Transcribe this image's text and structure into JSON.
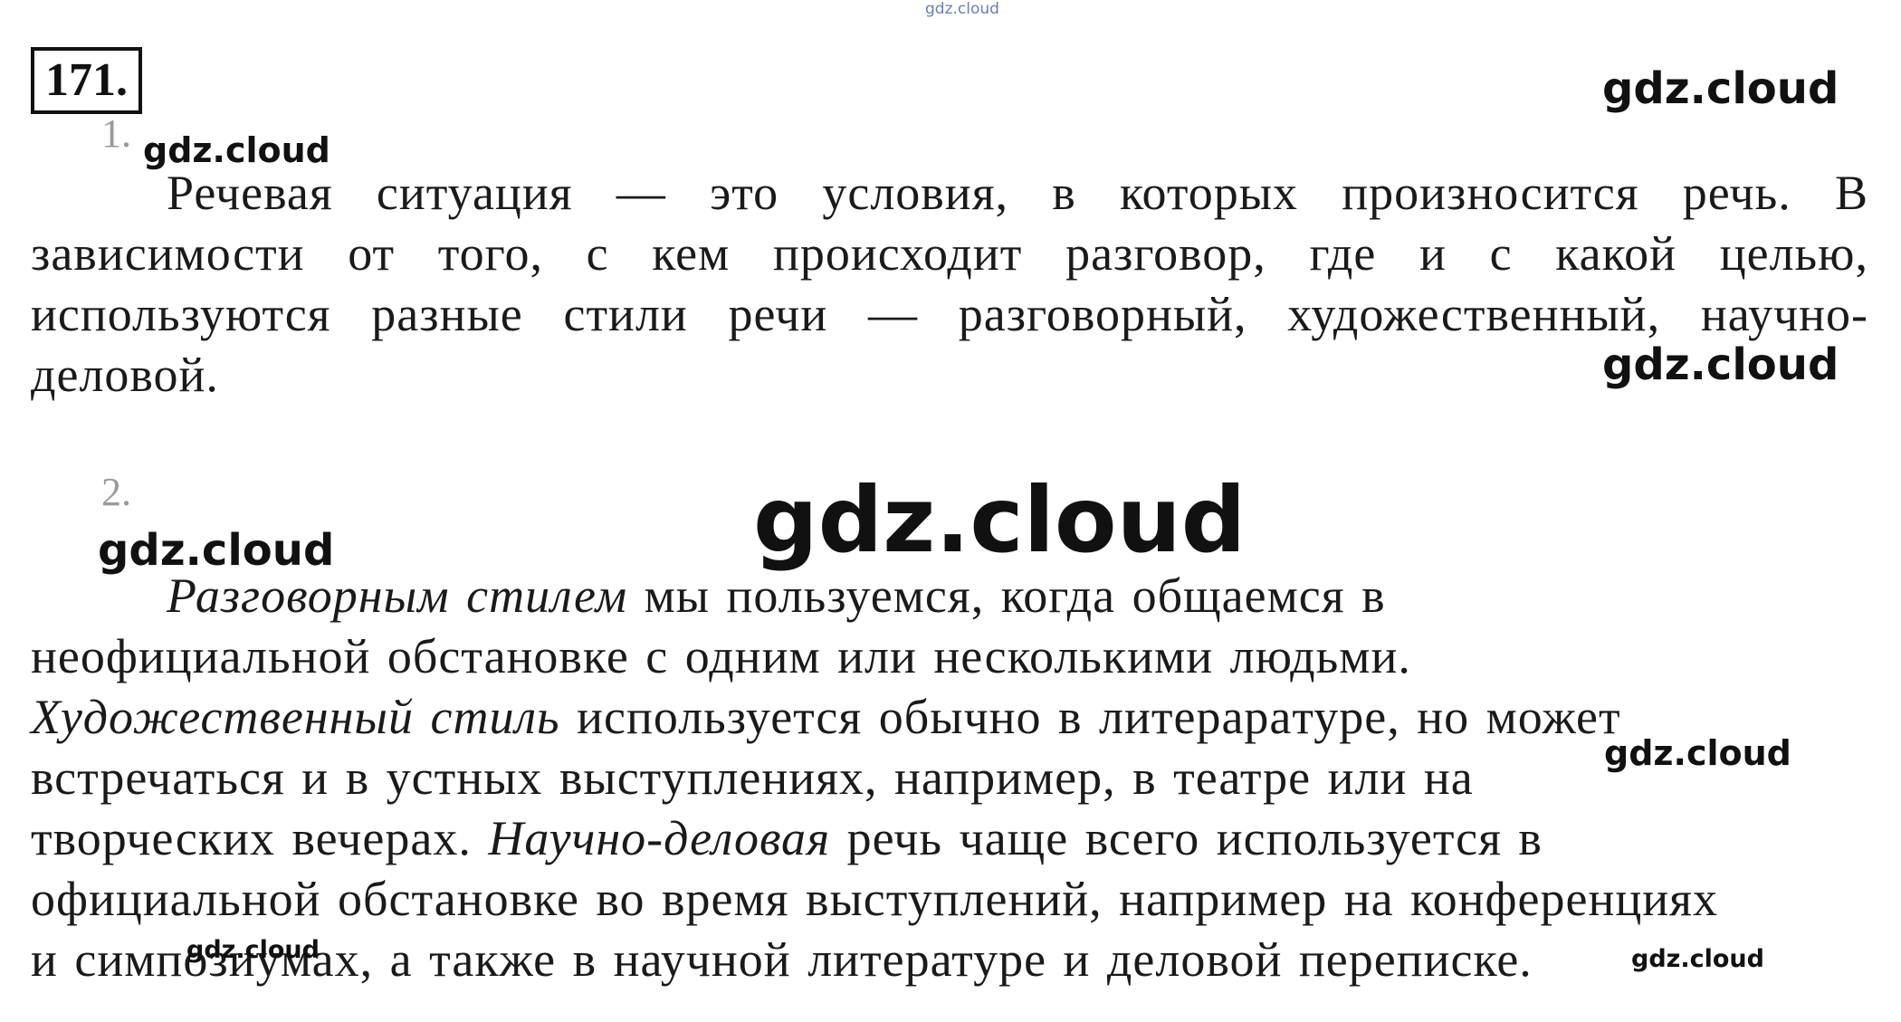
{
  "task_number": "171.",
  "items": [
    {
      "number": "1.",
      "text": "Речевая ситуация — это условия, в которых произносится речь. В зависимости от того, с кем происходит разговор, где и с какой целью, используются разные стили речи — разговорный, художественный, научно-деловой."
    },
    {
      "number": "2.",
      "lines": [
        {
          "i1": "Разговорным стилем",
          "t1": " мы пользуемся, когда общаемся в"
        },
        {
          "t1": "неофициальной обстановке с одним или несколькими людьми."
        },
        {
          "i1": "Художественный стиль",
          "t1": " используется обычно в литерарaтуре, но может"
        },
        {
          "t1": "встречаться и в устных выступлениях, например, в театре или на"
        },
        {
          "t1": "творческих вечерах. ",
          "i1": "Научно-деловая",
          "t2": " речь чаще всего используется в"
        },
        {
          "t1": "официальной обстановке во время выступлений, например на конференциях"
        },
        {
          "t1": "и симпозиумах, а также в научной литературе и деловой переписке."
        }
      ]
    }
  ],
  "watermarks": {
    "top_tiny": "gdz.cloud",
    "top_right": "gdz.cloud",
    "item1": "gdz.cloud",
    "mid_right": "gdz.cloud",
    "center_large": "gdz.cloud",
    "item2": "gdz.cloud",
    "right_lower": "gdz.cloud",
    "bottom_left": "gdz.cloud",
    "bottom_right": "gdz.cloud"
  }
}
